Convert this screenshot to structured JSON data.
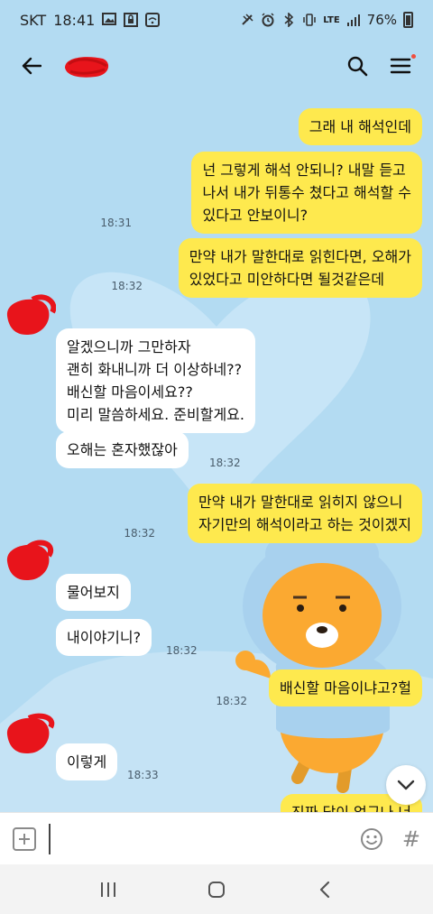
{
  "status_bar": {
    "carrier": "SKT",
    "time": "18:41",
    "network": "LTE",
    "battery": "76%"
  },
  "header": {
    "icons": [
      "back-arrow-icon",
      "search-icon",
      "menu-icon"
    ]
  },
  "messages": [
    {
      "side": "me",
      "text": "그래 내 해석인데",
      "time": ""
    },
    {
      "side": "me",
      "text": "넌 그렇게 해석 안되니? 내말 듣고\n나서 내가 뒤통수 쳤다고 해석할 수\n있다고 안보이니?",
      "time": "18:31"
    },
    {
      "side": "me",
      "text": "만약 내가 말한대로 읽힌다면, 오해가\n있었다고 미안하다면 될것같은데",
      "time": "18:32"
    },
    {
      "side": "them",
      "text": "알겠으니까 그만하자\n괜히 화내니까 더 이상하네??\n배신할 마음이세요??\n미리 말씀하세요. 준비할게요.",
      "time": ""
    },
    {
      "side": "them",
      "text": "오해는 혼자했잖아",
      "time": "18:32"
    },
    {
      "side": "me",
      "text": "만약 내가 말한대로 읽히지 않으니\n자기만의 해석이라고 하는 것이겠지",
      "time": "18:32"
    },
    {
      "side": "them",
      "text": "물어보지",
      "time": ""
    },
    {
      "side": "them",
      "text": "내이야기니?",
      "time": "18:32"
    },
    {
      "side": "me",
      "text": "배신할 마음이냐고?헐",
      "time": "18:32"
    },
    {
      "side": "them",
      "text": "이렇게",
      "time": "18:33"
    },
    {
      "side": "me",
      "text": "진짜 답이 없구나 너",
      "time": ""
    }
  ],
  "input": {
    "value": "",
    "placeholder": ""
  },
  "colors": {
    "background": "#b3dbf2",
    "my_bubble": "#fee94e",
    "their_bubble": "#ffffff",
    "redaction": "#e8141b"
  }
}
